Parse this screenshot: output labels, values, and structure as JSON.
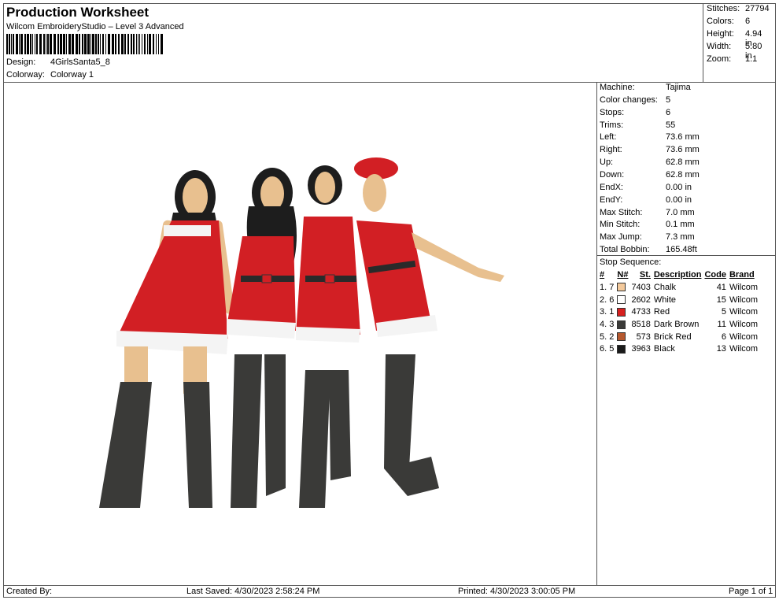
{
  "header": {
    "title": "Production Worksheet",
    "subtitle": "Wilcom EmbroideryStudio – Level 3 Advanced",
    "design_label": "Design:",
    "design_value": "4GirlsSanta5_8",
    "colorway_label": "Colorway:",
    "colorway_value": "Colorway 1"
  },
  "stats": [
    {
      "label": "Stitches:",
      "value": "27794"
    },
    {
      "label": "Colors:",
      "value": "6"
    },
    {
      "label": "Height:",
      "value": "4.94 in"
    },
    {
      "label": "Width:",
      "value": "5.80 in"
    },
    {
      "label": "Zoom:",
      "value": "1:1"
    }
  ],
  "spec": [
    {
      "label": "Machine:",
      "value": "Tajima"
    },
    {
      "label": "Color changes:",
      "value": "5"
    },
    {
      "label": "Stops:",
      "value": "6"
    },
    {
      "label": "Trims:",
      "value": "55"
    },
    {
      "label": "Left:",
      "value": "73.6 mm"
    },
    {
      "label": "Right:",
      "value": "73.6 mm"
    },
    {
      "label": "Up:",
      "value": "62.8 mm"
    },
    {
      "label": "Down:",
      "value": "62.8 mm"
    },
    {
      "label": "EndX:",
      "value": "0.00 in"
    },
    {
      "label": "EndY:",
      "value": "0.00 in"
    },
    {
      "label": "Max Stitch:",
      "value": "7.0 mm"
    },
    {
      "label": "Min Stitch:",
      "value": "0.1 mm"
    },
    {
      "label": "Max Jump:",
      "value": "7.3 mm"
    },
    {
      "label": "Total Bobbin:",
      "value": "165.48ft"
    }
  ],
  "stop_sequence": {
    "title": "Stop Sequence:",
    "headers": [
      "#",
      "N#",
      "St.",
      "Description",
      "Code",
      "Brand"
    ],
    "rows": [
      {
        "num": "1.",
        "n": "7",
        "color": "#f3c99b",
        "st": "7403",
        "desc": "Chalk",
        "code": "41",
        "brand": "Wilcom"
      },
      {
        "num": "2.",
        "n": "6",
        "color": "#ffffff",
        "st": "2602",
        "desc": "White",
        "code": "15",
        "brand": "Wilcom"
      },
      {
        "num": "3.",
        "n": "1",
        "color": "#d6201f",
        "st": "4733",
        "desc": "Red",
        "code": "5",
        "brand": "Wilcom"
      },
      {
        "num": "4.",
        "n": "3",
        "color": "#3a3a38",
        "st": "8518",
        "desc": "Dark Brown",
        "code": "11",
        "brand": "Wilcom"
      },
      {
        "num": "5.",
        "n": "2",
        "color": "#b5582e",
        "st": "573",
        "desc": "Brick Red",
        "code": "6",
        "brand": "Wilcom"
      },
      {
        "num": "6.",
        "n": "5",
        "color": "#1a1a1a",
        "st": "3963",
        "desc": "Black",
        "code": "13",
        "brand": "Wilcom"
      }
    ]
  },
  "footer": {
    "created_by": "Created By:",
    "last_saved": "Last Saved: 4/30/2023 2:58:24 PM",
    "printed": "Printed: 4/30/2023 3:00:05 PM",
    "page": "Page 1 of 1"
  }
}
